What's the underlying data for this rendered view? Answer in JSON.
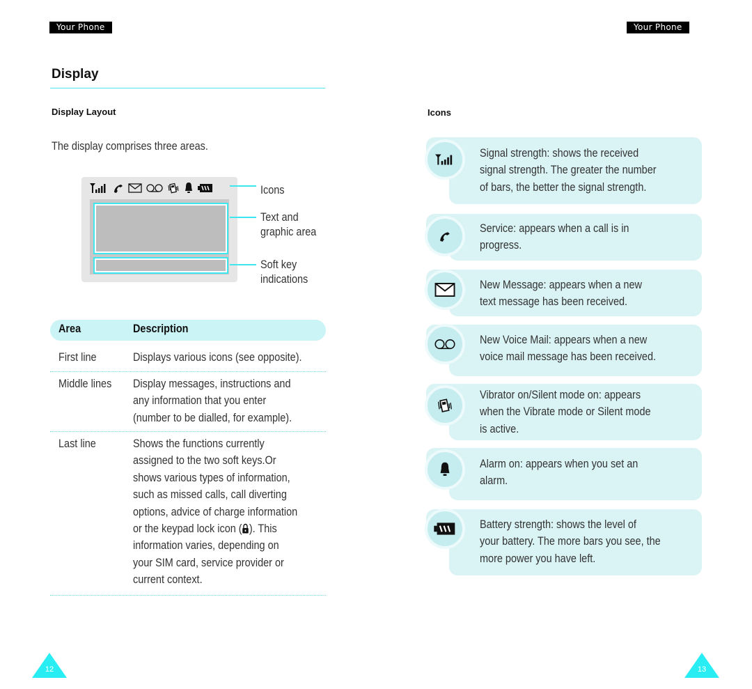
{
  "header": {
    "left_tag": "Your Phone",
    "right_tag": "Your Phone"
  },
  "left_page": {
    "title": "Display",
    "subtitle": "Display Layout",
    "intro": "The display comprises three areas.",
    "diagram": {
      "status_icons": [
        "signal-icon",
        "call-icon",
        "message-icon",
        "voicemail-icon",
        "vibrate-icon",
        "alarm-icon",
        "battery-icon"
      ],
      "callouts": {
        "icons": "Icons",
        "text_area_1": "Text and",
        "text_area_2": "graphic area",
        "softkey_1": "Soft key",
        "softkey_2": "indications"
      }
    },
    "table": {
      "headers": {
        "area": "Area",
        "description": "Description"
      },
      "rows": [
        {
          "area": "First line",
          "lines": [
            "Displays various icons (see opposite)."
          ]
        },
        {
          "area": "Middle lines",
          "lines": [
            "Display messages, instructions and",
            "any information that you enter",
            "(number to be dialled, for example)."
          ]
        },
        {
          "area": "Last line",
          "lines": [
            "Shows the functions currently",
            "assigned to the two soft keys.Or",
            "shows various types of information,",
            "such as missed calls, call diverting",
            "options, advice of charge information",
            "or the keypad lock icon (",
            "). This",
            "information varies, depending on",
            "your SIM card, service provider or",
            "current context."
          ]
        }
      ]
    },
    "page_number": "12"
  },
  "right_page": {
    "subtitle": "Icons",
    "icons": [
      {
        "icon": "signal-icon",
        "lines": [
          "Signal strength: shows the received",
          "signal strength. The greater the number",
          "of bars, the better the signal strength."
        ]
      },
      {
        "icon": "call-icon",
        "lines": [
          "Service: appears when a call is in",
          "progress."
        ]
      },
      {
        "icon": "message-icon",
        "lines": [
          "New Message: appears when a new",
          "text message has been received."
        ]
      },
      {
        "icon": "voicemail-icon",
        "lines": [
          "New Voice Mail: appears when a new",
          "voice mail message has been received."
        ]
      },
      {
        "icon": "vibrate-icon",
        "lines": [
          "Vibrator on/Silent mode on: appears",
          "when the Vibrate mode or Silent mode",
          "is active."
        ]
      },
      {
        "icon": "alarm-icon",
        "lines": [
          "Alarm on: appears when you set an",
          "alarm."
        ]
      },
      {
        "icon": "battery-icon",
        "lines": [
          "Battery strength: shows the level of",
          "your battery. The more bars you see, the",
          "more power you have left."
        ]
      }
    ],
    "page_number": "13"
  },
  "colors": {
    "accent": "#3fe6ee",
    "card_bg": "#daf3f4",
    "table_header_bg": "#cbf4f6",
    "page_triangle": "#28eef4"
  }
}
